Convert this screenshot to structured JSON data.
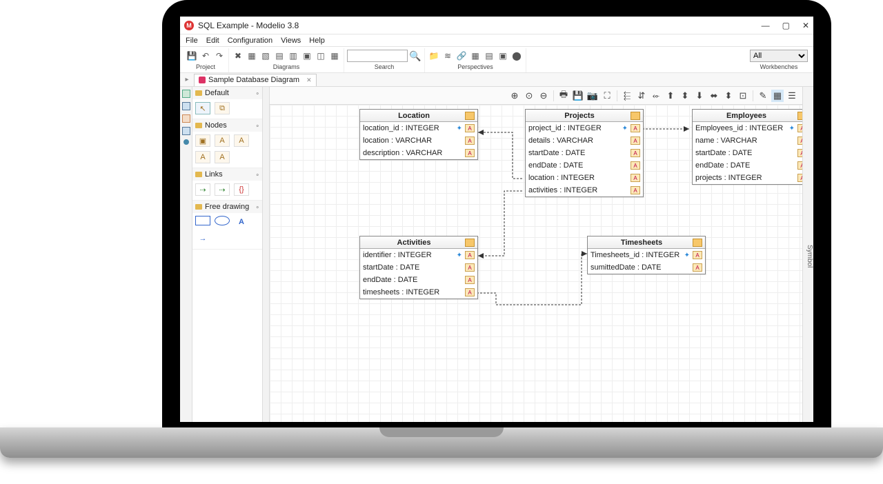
{
  "window": {
    "title": "SQL Example - Modelio 3.8",
    "app_icon_letter": "M"
  },
  "menu": {
    "file": "File",
    "edit": "Edit",
    "configuration": "Configuration",
    "views": "Views",
    "help": "Help"
  },
  "toolbar": {
    "group_project": "Project",
    "group_diagrams": "Diagrams",
    "group_search": "Search",
    "group_perspectives": "Perspectives",
    "group_workbenches": "Workbenches",
    "search_placeholder": "",
    "workbench_selected": "All"
  },
  "tab": {
    "label": "Sample Database Diagram"
  },
  "palette": {
    "default": "Default",
    "nodes": "Nodes",
    "links": "Links",
    "free_drawing": "Free drawing"
  },
  "right_rail": "Symbol",
  "tables": {
    "location": {
      "title": "Location",
      "rows": [
        {
          "text": "location_id : INTEGER",
          "pk": true
        },
        {
          "text": "location : VARCHAR"
        },
        {
          "text": "description : VARCHAR"
        }
      ]
    },
    "projects": {
      "title": "Projects",
      "rows": [
        {
          "text": "project_id : INTEGER",
          "pk": true
        },
        {
          "text": "details : VARCHAR"
        },
        {
          "text": "startDate : DATE"
        },
        {
          "text": "endDate : DATE"
        },
        {
          "text": "location : INTEGER",
          "fk": true
        },
        {
          "text": "activities : INTEGER",
          "fk": true
        }
      ]
    },
    "employees": {
      "title": "Employees",
      "rows": [
        {
          "text": "Employees_id : INTEGER",
          "pk": true
        },
        {
          "text": "name : VARCHAR"
        },
        {
          "text": "startDate : DATE"
        },
        {
          "text": "endDate : DATE"
        },
        {
          "text": "projects : INTEGER",
          "fk": true
        }
      ]
    },
    "activities": {
      "title": "Activities",
      "rows": [
        {
          "text": "identifier : INTEGER",
          "pk": true
        },
        {
          "text": "startDate : DATE"
        },
        {
          "text": "endDate : DATE"
        },
        {
          "text": "timesheets : INTEGER",
          "fk": true
        }
      ]
    },
    "timesheets": {
      "title": "Timesheets",
      "rows": [
        {
          "text": "Timesheets_id : INTEGER",
          "pk": true
        },
        {
          "text": "sumittedDate : DATE"
        }
      ]
    }
  }
}
